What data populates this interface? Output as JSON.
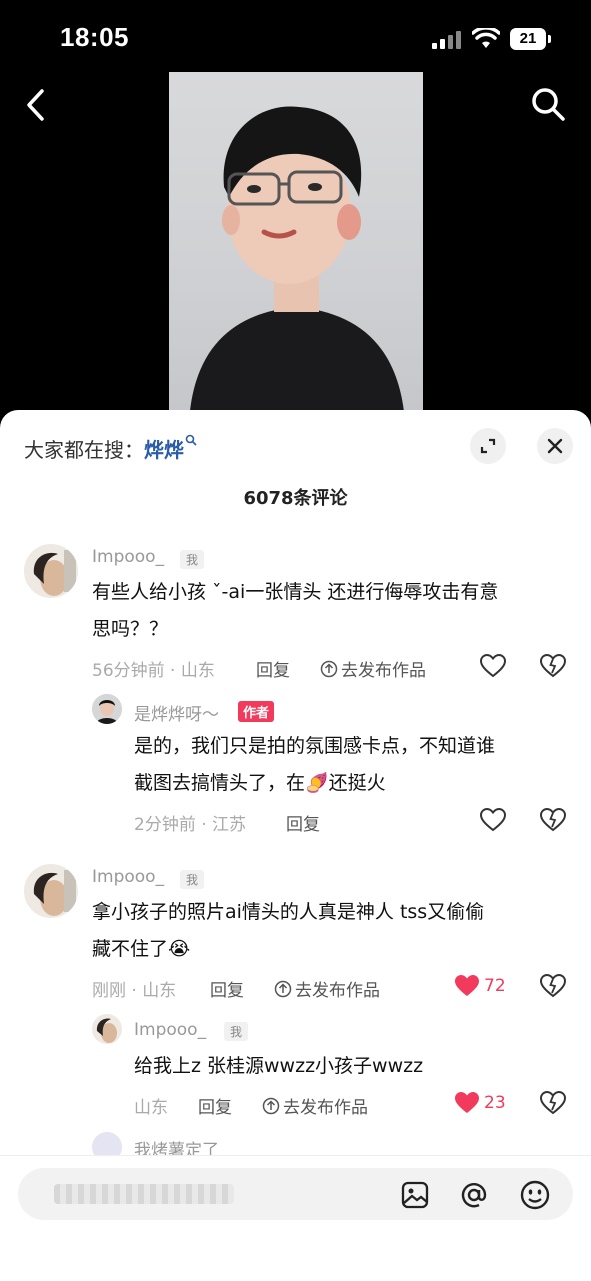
{
  "status_bar": {
    "time": "18:05",
    "battery": "21"
  },
  "sheet": {
    "hot_search_label": "大家都在搜：",
    "hot_search_keyword": "烨烨",
    "comment_count": "6078条评论"
  },
  "comments": [
    {
      "user": "Impooo_",
      "tag": "我",
      "text_line1": "有些人给小孩 ˇ-ai一张情头 还进行侮辱攻击有意",
      "text_line2": "思吗？？",
      "meta": "56分钟前 · 山东",
      "reply": "回复",
      "publish": "去发布作品",
      "likes": ""
    },
    {
      "user": "是烨烨呀～",
      "tag": "作者",
      "text_line1": "是的，我们只是拍的氛围感卡点，不知道谁",
      "text_line2": "截图去搞情头了，在🍠还挺火",
      "meta": "2分钟前 · 江苏",
      "reply": "回复",
      "likes": ""
    },
    {
      "user": "Impooo_",
      "tag": "我",
      "text_line1": "拿小孩子的照片ai情头的人真是神人 tss又偷偷",
      "text_line2": "藏不住了😭",
      "meta": "刚刚 · 山东",
      "reply": "回复",
      "publish": "去发布作品",
      "likes": "72"
    },
    {
      "user": "Impooo_",
      "tag": "我",
      "text_line1": "给我上z 张桂源wwzz小孩子wwzz",
      "meta": "山东",
      "reply": "回复",
      "publish": "去发布作品",
      "likes": "23"
    },
    {
      "user": "我烤薯定了"
    }
  ],
  "colors": {
    "accent_red": "#f13a5c",
    "keyword_blue": "#2a5caa"
  },
  "icons": [
    "back-icon",
    "search-icon",
    "expand-icon",
    "close-icon",
    "heart-icon",
    "dislike-heart-icon",
    "publish-icon",
    "image-icon",
    "at-icon",
    "emoji-icon"
  ]
}
